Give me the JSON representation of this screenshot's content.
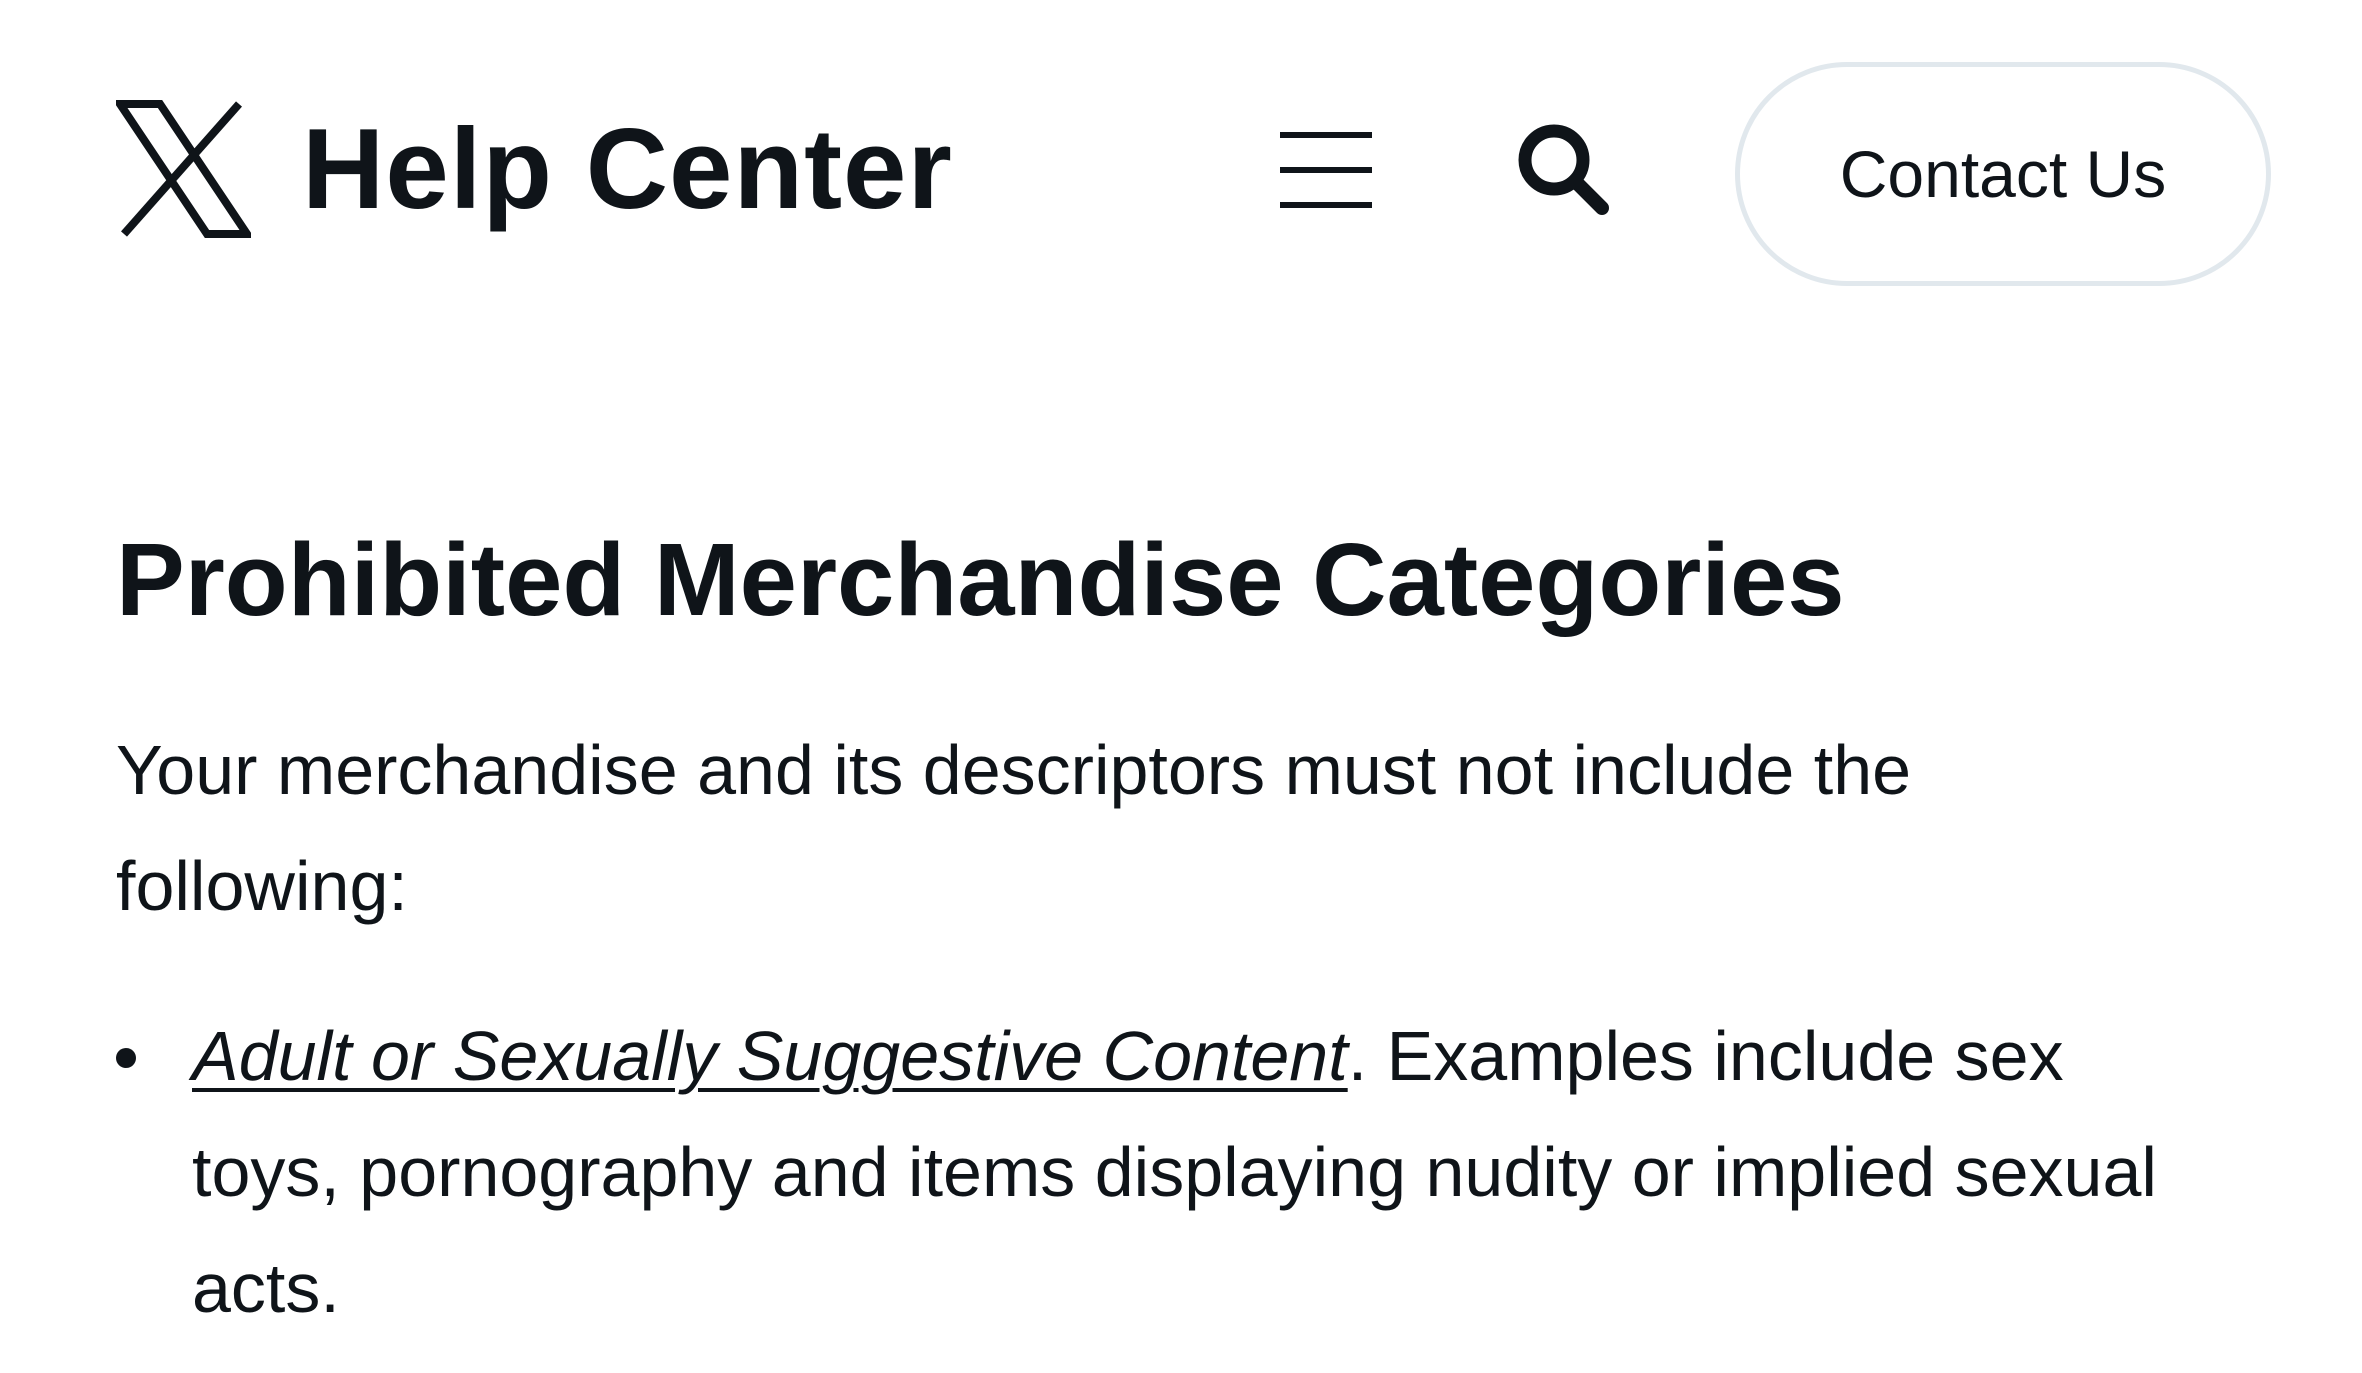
{
  "header": {
    "logo_icon": "x-logo-icon",
    "title": "Help Center",
    "menu_icon": "hamburger-menu-icon",
    "search_icon": "search-icon",
    "contact_label": "Contact Us"
  },
  "main": {
    "title": "Prohibited Merchandise Categories",
    "intro": "Your merchandise and its descriptors must not include the following:",
    "items": [
      {
        "link_label": "Adult or Sexually Suggestive Content",
        "text": ". Examples include sex toys, pornography and items displaying nudity or implied sexual acts."
      }
    ]
  },
  "colors": {
    "text": "#0f1419",
    "button_border": "#e1e8ed",
    "background": "#ffffff"
  }
}
